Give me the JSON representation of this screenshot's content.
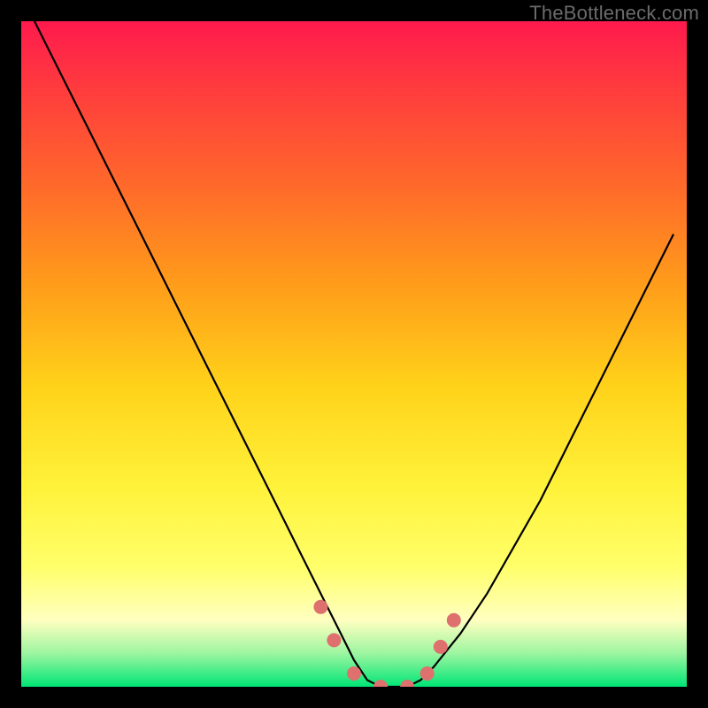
{
  "watermark": "TheBottleneck.com",
  "colors": {
    "frame": "#000000",
    "curve": "#000000",
    "marker": "#de706e",
    "gradient_stops": [
      {
        "pos": 0,
        "hex": "#ff1a4d"
      },
      {
        "pos": 10,
        "hex": "#ff3b3e"
      },
      {
        "pos": 25,
        "hex": "#ff6a2a"
      },
      {
        "pos": 40,
        "hex": "#ff9e1a"
      },
      {
        "pos": 55,
        "hex": "#ffd31a"
      },
      {
        "pos": 70,
        "hex": "#fff23a"
      },
      {
        "pos": 82,
        "hex": "#ffff6a"
      },
      {
        "pos": 90,
        "hex": "#ffffc0"
      },
      {
        "pos": 95,
        "hex": "#9cf5a0"
      },
      {
        "pos": 100,
        "hex": "#00e676"
      }
    ]
  },
  "chart_data": {
    "type": "line",
    "title": "",
    "xlabel": "",
    "ylabel": "",
    "xlim": [
      0,
      100
    ],
    "ylim": [
      0,
      100
    ],
    "grid": false,
    "legend": false,
    "series": [
      {
        "name": "bottleneck-curve",
        "x": [
          2,
          6,
          10,
          14,
          18,
          22,
          26,
          30,
          34,
          38,
          42,
          44,
          46,
          48,
          50,
          52,
          54,
          56,
          58,
          60,
          62,
          66,
          70,
          74,
          78,
          82,
          86,
          90,
          94,
          98
        ],
        "y": [
          100,
          92,
          84,
          76,
          68,
          60,
          52,
          44,
          36,
          28,
          20,
          16,
          12,
          8,
          4,
          1,
          0,
          0,
          0,
          1,
          3,
          8,
          14,
          21,
          28,
          36,
          44,
          52,
          60,
          68
        ]
      }
    ],
    "markers": [
      {
        "x": 45,
        "y": 12
      },
      {
        "x": 47,
        "y": 7
      },
      {
        "x": 50,
        "y": 2
      },
      {
        "x": 54,
        "y": 0
      },
      {
        "x": 58,
        "y": 0
      },
      {
        "x": 61,
        "y": 2
      },
      {
        "x": 63,
        "y": 6
      },
      {
        "x": 65,
        "y": 10
      }
    ],
    "annotations": []
  }
}
